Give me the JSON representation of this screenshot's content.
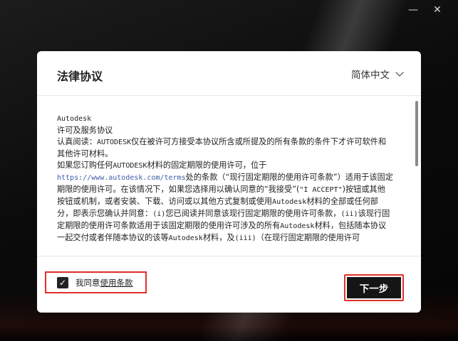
{
  "window": {
    "minimize_glyph": "—",
    "close_glyph": "✕"
  },
  "dialog": {
    "title": "法律协议",
    "language": "简体中文"
  },
  "terms": {
    "company": "Autodesk",
    "heading": "许可及服务协议",
    "p1_prefix": "认真阅读：",
    "p1_brand": "AUTODESK",
    "p1_rest": "仅在被许可方接受本协议所含或所提及的所有条款的条件下才许可软件和其他许可材料。",
    "p2_a": "如果您订购任何",
    "p2_brand": "AUTODESK",
    "p2_b": "材料的固定期限的使用许可，位于",
    "p2_url": "https://www.autodesk.com/terms",
    "p2_c": "处的条款（“现行固定期限的使用许可条款”）适用于该固定期限的使用许可。在该情况下，如果您选择用以确认同意的“我接受”(",
    "p2_accept": "\"I ACCEPT\"",
    "p2_d": ")按钮或其他按钮或机制，或者安装、下载、访问或以其他方式复制或使用",
    "p2_brand2": "Autodesk",
    "p2_e": "材料的全部或任何部分，即表示您确认并同意：",
    "p2_i": "(i)",
    "p2_f": "您已阅读并同意该现行固定期限的使用许可条款，",
    "p2_ii": "(ii)",
    "p2_g": "该现行固定期限的使用许可条款适用于该固定期限的使用许可涉及的所有",
    "p2_brand3": "Autodesk",
    "p2_h": "材料，包括随本协议一起交付或者伴随本协议的该等",
    "p2_brand4": "Autodesk",
    "p2_j": "材料，及",
    "p2_iii": "(iii)",
    "p2_k": "（在现行固定期限的使用许可"
  },
  "footer": {
    "agree_prefix": "我同意",
    "agree_link": "使用条款",
    "next_label": "下一步",
    "checkmark": "✓"
  }
}
